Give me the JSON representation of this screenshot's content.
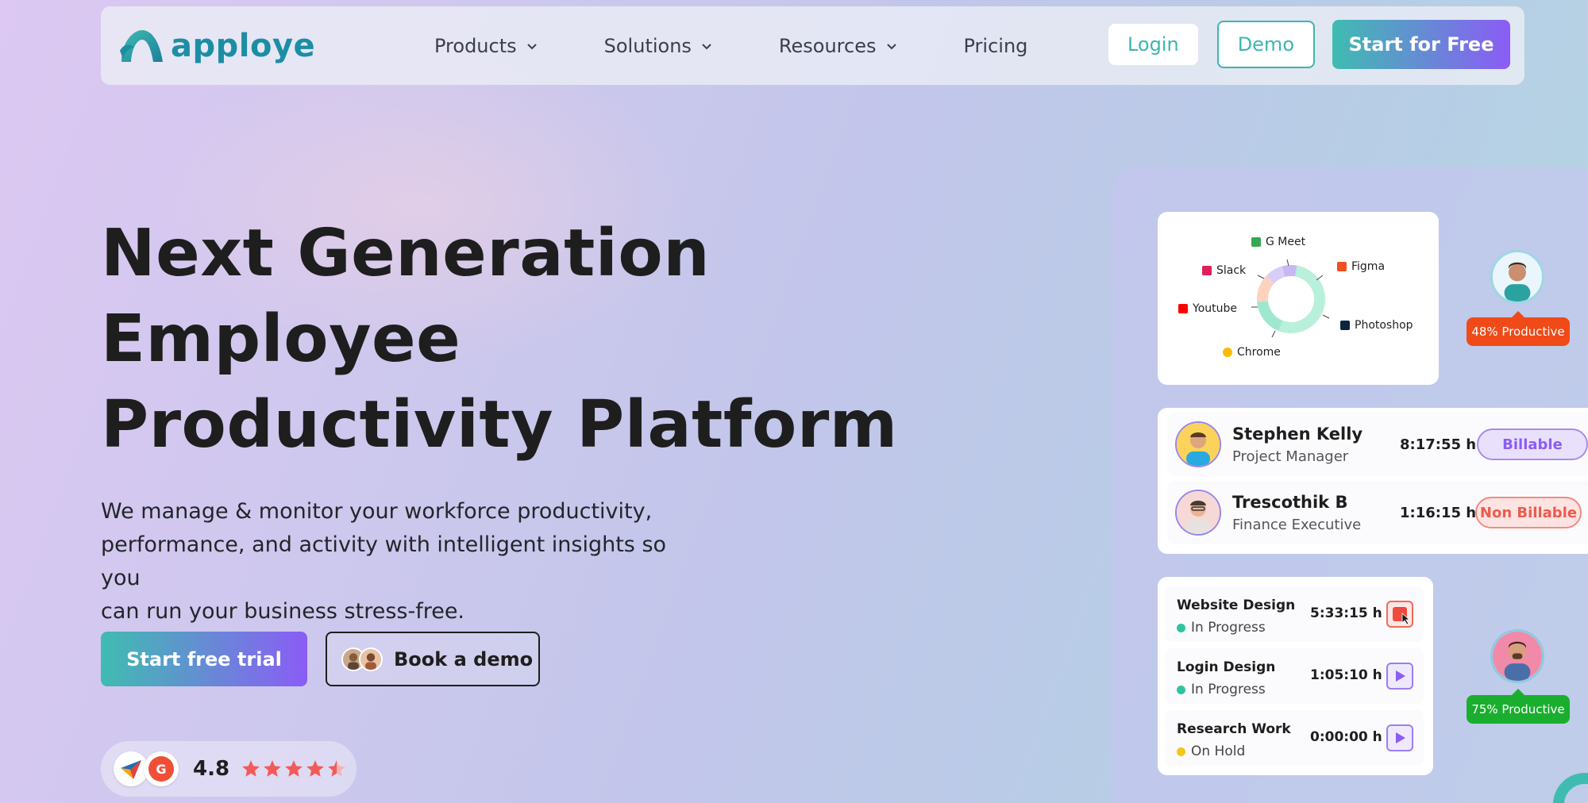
{
  "brand": {
    "name": "apploye",
    "color": "#1c8ea4",
    "accent": "#3fbcb1",
    "accent2": "#8b5cf6"
  },
  "nav": {
    "items": [
      {
        "label": "Products",
        "dropdown": true
      },
      {
        "label": "Solutions",
        "dropdown": true
      },
      {
        "label": "Resources",
        "dropdown": true
      },
      {
        "label": "Pricing",
        "dropdown": false
      }
    ],
    "login": "Login",
    "demo": "Demo",
    "start": "Start for Free"
  },
  "hero": {
    "title_lines": [
      "Next Generation",
      "Employee",
      "Productivity Platform"
    ],
    "subtitle_lines": [
      "We manage & monitor your workforce productivity,",
      "performance, and activity with intelligent insights so you",
      "can run your business stress-free."
    ],
    "cta_trial": "Start free trial",
    "cta_demo": "Book a demo",
    "rating_value": "4.8",
    "rating_stars": 4.5
  },
  "usage_card": {
    "apps": [
      "G Meet",
      "Slack",
      "Figma",
      "Youtube",
      "Photoshop",
      "Chrome"
    ]
  },
  "people": [
    {
      "name": "Stephen Kelly",
      "role": "Project Manager",
      "time": "8:17:55 h",
      "tag": "Billable"
    },
    {
      "name": "Trescothik B",
      "role": "Finance Executive",
      "time": "1:16:15 h",
      "tag": "Non Billable"
    }
  ],
  "tasks": [
    {
      "name": "Website Design",
      "status": "In Progress",
      "status_color": "#2fc4a1",
      "time": "5:33:15 h",
      "action": "stop"
    },
    {
      "name": "Login Design",
      "status": "In Progress",
      "status_color": "#2fc4a1",
      "time": "1:05:10 h",
      "action": "play"
    },
    {
      "name": "Research Work",
      "status": "On Hold",
      "status_color": "#f5c518",
      "time": "0:00:00 h",
      "action": "play"
    }
  ],
  "productivity": [
    {
      "label": "48% Productive",
      "color": "#ef4a18"
    },
    {
      "label": "75% Productive",
      "color": "#1aae2e"
    }
  ]
}
